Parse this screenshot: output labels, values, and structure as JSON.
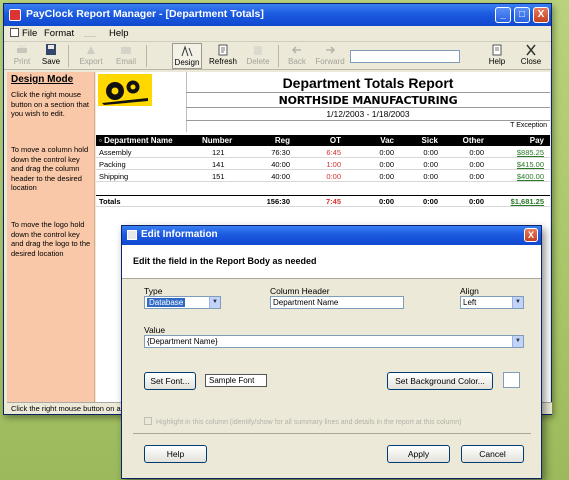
{
  "window": {
    "title": "PayClock Report Manager - [Department Totals]",
    "minimize": "_",
    "maximize": "□",
    "close": "X"
  },
  "menu": {
    "items": [
      "File",
      "Format",
      "Help"
    ]
  },
  "toolbar": {
    "print": "Print",
    "save": "Save",
    "export": "Export",
    "email": "Email",
    "design": "Design",
    "refresh": "Refresh",
    "delete": "Delete",
    "back": "Back",
    "forward": "Forward",
    "help": "Help",
    "close": "Close"
  },
  "side_panel": {
    "heading": "Design Mode",
    "tip1": "Click the right mouse button on a section that you wish to edit.",
    "tip2": "To move a column hold down the control key and drag the column header to the desired location",
    "tip3": "To move the logo hold down the control key and drag the logo to the desired location"
  },
  "report": {
    "title": "Department Totals Report",
    "company": "NORTHSIDE MANUFACTURING",
    "date_range": "1/12/2003 - 1/18/2003",
    "exception_note": "T Exception",
    "columns": [
      "Department Name",
      "Number",
      "Reg",
      "OT",
      "Vac",
      "Sick",
      "Other",
      "Pay"
    ],
    "rows": [
      {
        "name": "Assembly",
        "number": "121",
        "reg": "76:30",
        "ot": "6:45",
        "vac": "0:00",
        "sick": "0:00",
        "other": "0:00",
        "pay": "$885.25"
      },
      {
        "name": "Packing",
        "number": "141",
        "reg": "40:00",
        "ot": "1:00",
        "vac": "0:00",
        "sick": "0:00",
        "other": "0:00",
        "pay": "$415.00"
      },
      {
        "name": "Shipping",
        "number": "151",
        "reg": "40:00",
        "ot": "0:00",
        "vac": "0:00",
        "sick": "0:00",
        "other": "0:00",
        "pay": "$400.00"
      }
    ],
    "totals": {
      "label": "Totals",
      "reg": "156:30",
      "ot": "7:45",
      "vac": "0:00",
      "sick": "0:00",
      "other": "0:00",
      "pay": "$1,681.25"
    }
  },
  "status_bar": {
    "text": "Click the right mouse button on a"
  },
  "dialog": {
    "title": "Edit Information",
    "close": "X",
    "instruction": "Edit the field in the Report Body as needed",
    "type_label": "Type",
    "type_value": "Database",
    "column_header_label": "Column Header",
    "column_header_value": "Department Name",
    "align_label": "Align",
    "align_value": "Left",
    "value_label": "Value",
    "value_value": "{Department Name}",
    "set_font": "Set Font...",
    "sample_font": "Sample Font",
    "set_bg_color": "Set Background Color...",
    "disabled_check_text": "Highlight in this column (identify/show for all summary lines and details in the report at this column)",
    "help": "Help",
    "apply": "Apply",
    "cancel": "Cancel"
  },
  "colors": {
    "titlebar": "#1c5ae0",
    "side_panel": "#f9c8a8",
    "ot_red": "#d93030",
    "pay_green": "#2a7a2a",
    "logo_yellow": "#ffd800",
    "background": "#a8c568"
  }
}
